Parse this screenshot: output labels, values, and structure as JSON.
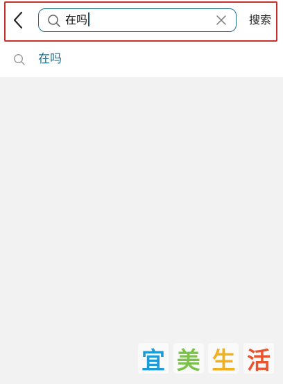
{
  "header": {
    "back_icon": "chevron-left-icon",
    "search": {
      "icon": "search-icon",
      "value": "在吗",
      "clear_icon": "close-icon"
    },
    "action_label": "搜索"
  },
  "suggestions": [
    {
      "icon": "search-icon",
      "text": "在吗"
    }
  ],
  "watermark": {
    "chars": [
      "宜",
      "美",
      "生",
      "活"
    ],
    "colors": [
      "#1e9bd7",
      "#7cc24a",
      "#f2b11b",
      "#e8542e"
    ]
  },
  "colors": {
    "accent": "#1f6f8f",
    "highlight_border": "#c9302c",
    "background": "#f2f2f2"
  }
}
